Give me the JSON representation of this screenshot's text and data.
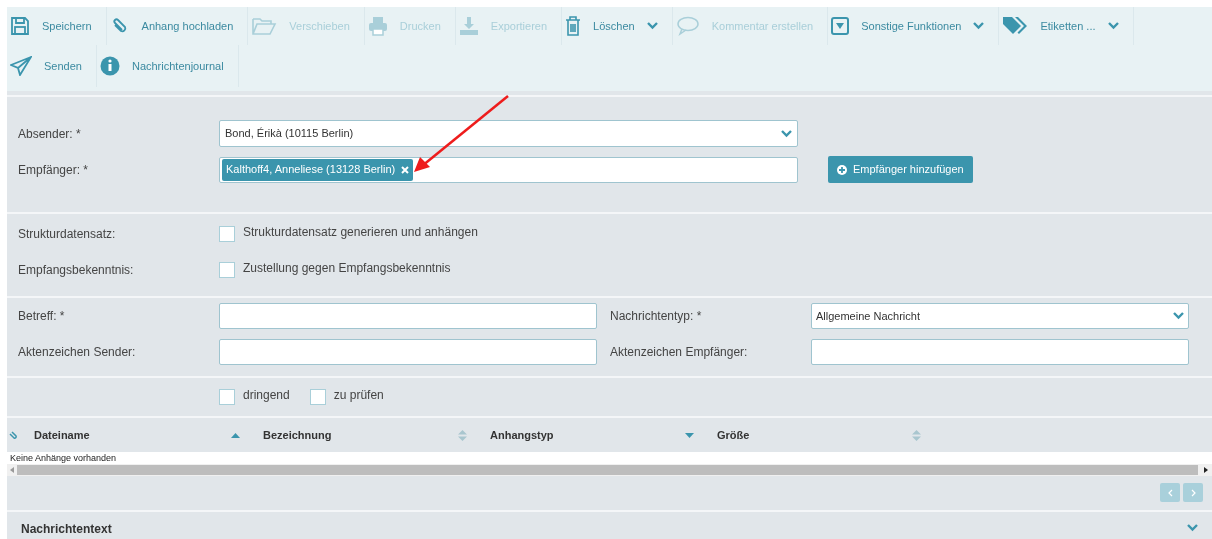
{
  "toolbar": {
    "rows": [
      [
        {
          "label": "Speichern",
          "disabled": false,
          "dropdown": false
        },
        {
          "label": "Anhang hochladen",
          "disabled": false,
          "dropdown": false
        },
        {
          "label": "Verschieben",
          "disabled": true,
          "dropdown": false
        },
        {
          "label": "Drucken",
          "disabled": true,
          "dropdown": false
        },
        {
          "label": "Exportieren",
          "disabled": true,
          "dropdown": false
        },
        {
          "label": "Löschen",
          "disabled": false,
          "dropdown": true
        },
        {
          "label": "Kommentar erstellen",
          "disabled": true,
          "dropdown": false
        },
        {
          "label": "Sonstige Funktionen",
          "disabled": false,
          "dropdown": true
        },
        {
          "label": "Etiketten ...",
          "disabled": false,
          "dropdown": true
        }
      ],
      [
        {
          "label": "Senden",
          "disabled": false,
          "dropdown": false
        },
        {
          "label": "Nachrichtenjournal",
          "disabled": false,
          "dropdown": false
        }
      ]
    ]
  },
  "addressing": {
    "sender": {
      "label": "Absender: *",
      "value": "Bond, Érikà (10115 Berlin)"
    },
    "recipient": {
      "label": "Empfänger: *",
      "tags": [
        "Kalthoff4, Anneliese (13128 Berlin)"
      ]
    },
    "add_button": "Empfänger hinzufügen"
  },
  "options": [
    {
      "label": "Strukturdatensatz:",
      "text": "Strukturdatensatz generieren und anhängen",
      "checked": false
    },
    {
      "label": "Empfangsbekenntnis:",
      "text": "Zustellung gegen Empfangsbekenntnis",
      "checked": false
    }
  ],
  "details": {
    "subject": {
      "label": "Betreff: *"
    },
    "message_type": {
      "label": "Nachrichtentyp: *",
      "value": "Allgemeine Nachricht"
    },
    "sender_reference": {
      "label": "Aktenzeichen Sender:"
    },
    "recipient_reference": {
      "label": "Aktenzeichen Empfänger:"
    }
  },
  "flags": [
    {
      "label": "dringend",
      "checked": false
    },
    {
      "label": "zu prüfen",
      "checked": false
    }
  ],
  "attachments": {
    "columns": [
      {
        "label": "Dateiname",
        "kind": "ascending"
      },
      {
        "label": "Bezeichnung",
        "kind": "unsorted"
      },
      {
        "label": "Anhangstyp",
        "kind": "descending"
      },
      {
        "label": "Größe",
        "kind": "unsorted"
      }
    ],
    "empty_text": "Keine Anhänge vorhanden"
  },
  "message_text": {
    "title": "Nachrichtentext",
    "expanded": false
  }
}
